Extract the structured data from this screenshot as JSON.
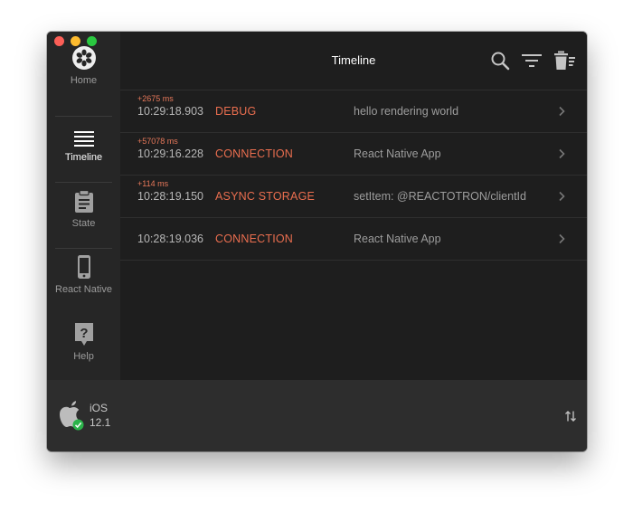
{
  "window": {
    "title": "Timeline"
  },
  "sidebar": {
    "items": [
      {
        "label": "Home",
        "icon": "home-icon"
      },
      {
        "label": "Timeline",
        "icon": "timeline-icon",
        "active": true
      },
      {
        "label": "State",
        "icon": "state-icon"
      },
      {
        "label": "React Native",
        "icon": "phone-icon"
      },
      {
        "label": "Help",
        "icon": "help-icon"
      }
    ]
  },
  "toolbar": {
    "icons": [
      "search-icon",
      "filter-icon",
      "trash-icon"
    ]
  },
  "timeline": {
    "rows": [
      {
        "delta": "+2675 ms",
        "time": "10:29:18.903",
        "type": "DEBUG",
        "message": "hello rendering world"
      },
      {
        "delta": "+57078 ms",
        "time": "10:29:16.228",
        "type": "CONNECTION",
        "message": "React Native App"
      },
      {
        "delta": "+114 ms",
        "time": "10:28:19.150",
        "type": "ASYNC STORAGE",
        "message": "setItem: @REACTOTRON/clientId"
      },
      {
        "delta": "",
        "time": "10:28:19.036",
        "type": "CONNECTION",
        "message": "React Native App"
      }
    ]
  },
  "footer": {
    "os_name": "iOS",
    "os_version": "12.1",
    "status": "connected"
  },
  "colors": {
    "accent": "#ea6e4f",
    "background": "#1e1e1e",
    "sidebar": "#262626",
    "footer": "#2d2d2d",
    "connected": "#2bb34a"
  }
}
